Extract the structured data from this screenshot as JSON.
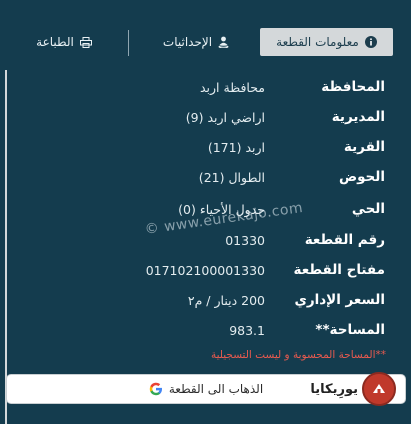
{
  "tabs": {
    "info": "معلومات القطعة",
    "coordinates": "الإحداثيات",
    "print": "الطباعة"
  },
  "rows": [
    {
      "label": "المحافظة",
      "value": "محافظة اربد"
    },
    {
      "label": "المديرية",
      "value": "اراضي اربد (9)"
    },
    {
      "label": "القرية",
      "value": "اربد (171)"
    },
    {
      "label": "الحوض",
      "value": "الطوال (21)"
    },
    {
      "label": "الحي",
      "value": "جدول الأحياء (0)"
    },
    {
      "label": "رقم القطعة",
      "value": "01330"
    },
    {
      "label": "مفتاح القطعة",
      "value": "017102100001330"
    },
    {
      "label": "السعر الإداري",
      "value": "200 دينار / م٢"
    },
    {
      "label": "المساحة**",
      "value": "983.1"
    }
  ],
  "note": "**المساحة المحسوبة و ليست التسجيلية",
  "watermark": "© www.eurekajo.com",
  "goto_button": "الذهاب الى القطعة",
  "logo_text": "يورِيكايا",
  "colors": {
    "background": "#143c4e",
    "note": "#e85a4f",
    "active_tab": "#d4d8da"
  }
}
